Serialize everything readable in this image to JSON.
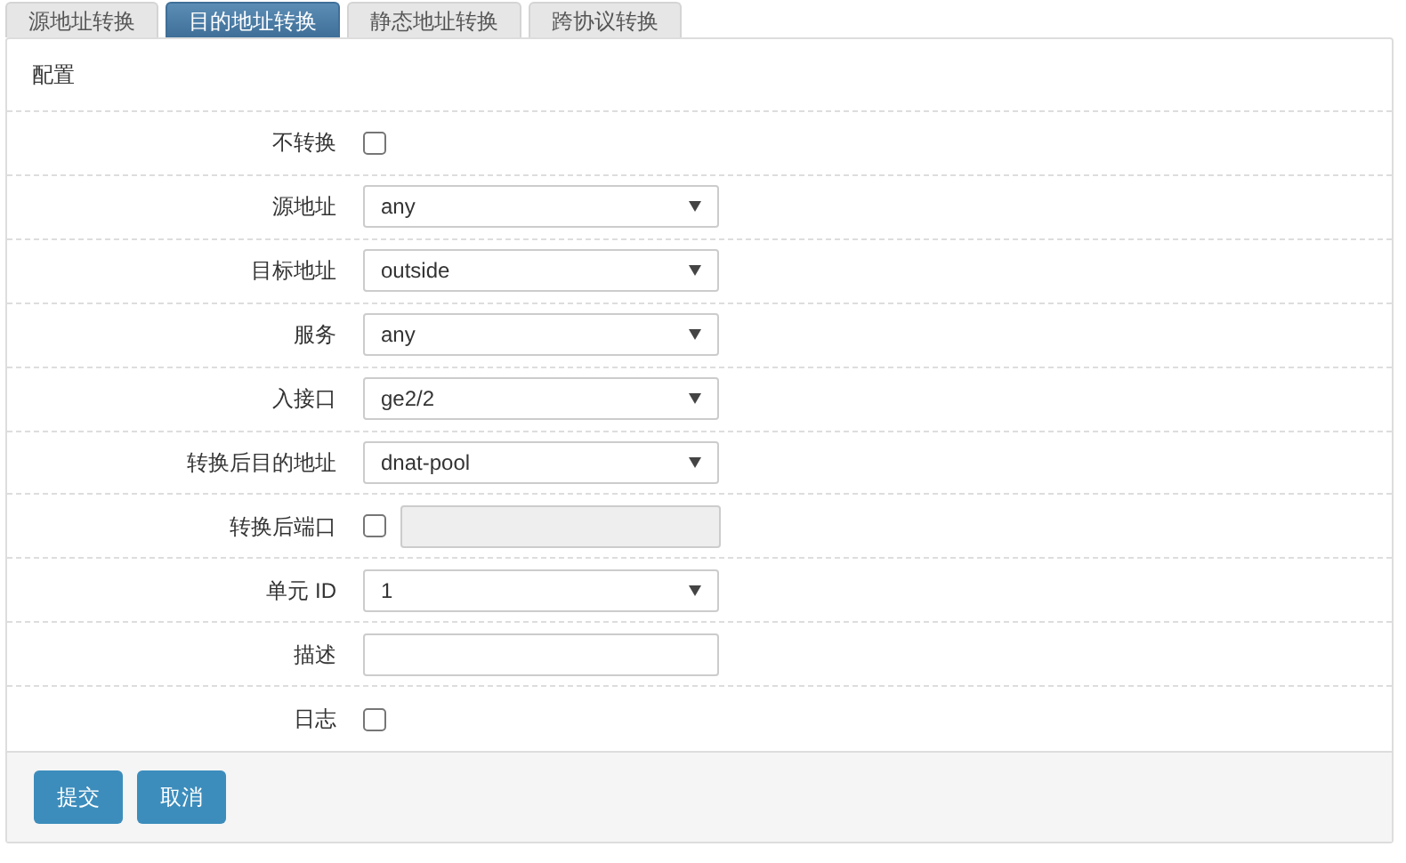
{
  "tabs": [
    {
      "label": "源地址转换",
      "selected": false
    },
    {
      "label": "目的地址转换",
      "selected": true
    },
    {
      "label": "静态地址转换",
      "selected": false
    },
    {
      "label": "跨协议转换",
      "selected": false
    }
  ],
  "panel": {
    "title": "配置"
  },
  "fields": [
    {
      "kind": "checkbox",
      "label": "不转换",
      "checked": false
    },
    {
      "kind": "select",
      "label": "源地址",
      "value": "any"
    },
    {
      "kind": "select",
      "label": "目标地址",
      "value": "outside"
    },
    {
      "kind": "select",
      "label": "服务",
      "value": "any"
    },
    {
      "kind": "select",
      "label": "入接口",
      "value": "ge2/2"
    },
    {
      "kind": "select",
      "label": "转换后目的地址",
      "value": "dnat-pool"
    },
    {
      "kind": "checkbox-input",
      "label": "转换后端口",
      "checked": false,
      "disabled": true
    },
    {
      "kind": "select",
      "label": "单元 ID",
      "value": "1"
    },
    {
      "kind": "text",
      "label": "描述"
    },
    {
      "kind": "checkbox",
      "label": "日志",
      "checked": false
    }
  ],
  "buttons": [
    "提交",
    "取消"
  ]
}
